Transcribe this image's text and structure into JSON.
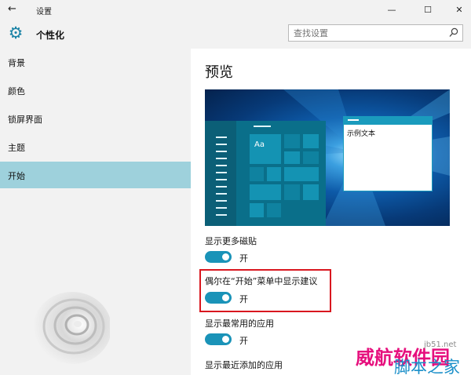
{
  "window": {
    "title": "设置",
    "back_glyph": "←",
    "minimize_glyph": "—",
    "maximize_glyph": "☐",
    "close_glyph": "✕"
  },
  "header": {
    "title": "个性化",
    "gear_glyph": "⚙",
    "search_placeholder": "查找设置",
    "icons": [
      "gear-icon",
      "search-icon"
    ]
  },
  "sidebar": {
    "items": [
      {
        "label": "背景",
        "active": false
      },
      {
        "label": "颜色",
        "active": false
      },
      {
        "label": "锁屏界面",
        "active": false
      },
      {
        "label": "主题",
        "active": false
      },
      {
        "label": "开始",
        "active": true
      }
    ],
    "active_color": "#9ed1dc"
  },
  "main": {
    "title": "预览",
    "preview": {
      "tile_label": "Aa",
      "sample_text": "示例文本"
    },
    "settings": [
      {
        "label": "显示更多磁贴",
        "state": "开",
        "on": true
      },
      {
        "label": "偶尔在“开始”菜单中显示建议",
        "state": "开",
        "on": true
      },
      {
        "label": "显示最常用的应用",
        "state": "开",
        "on": true
      },
      {
        "label": "显示最近添加的应用",
        "on": true
      }
    ]
  },
  "watermark": {
    "line1": "威航软件园",
    "line2": "脚本之家",
    "site": "jb51.net"
  },
  "colors": {
    "accent": "#1a93b8",
    "highlight_border": "#d9171f",
    "chrome": "#f2f2f2"
  }
}
